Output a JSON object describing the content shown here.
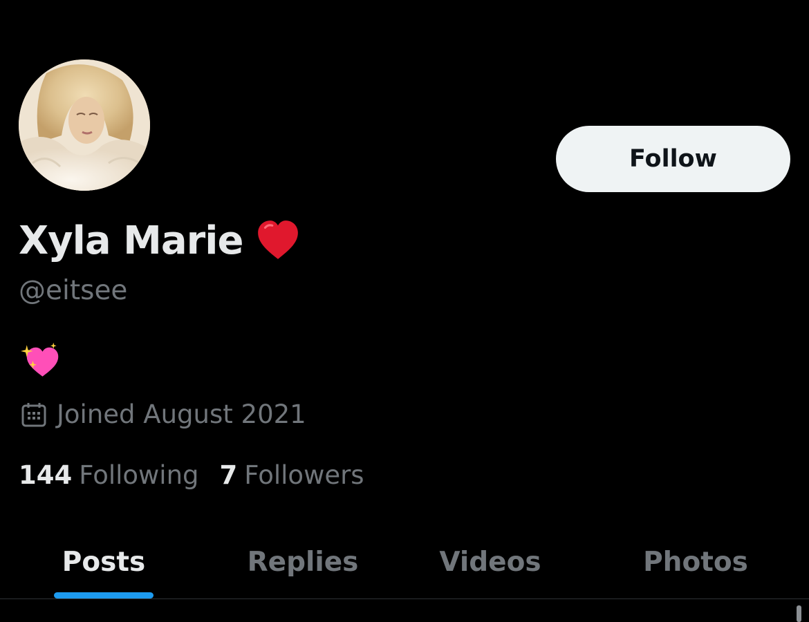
{
  "profile": {
    "display_name": "Xyla Marie",
    "name_emoji": "red-heart",
    "handle": "@eitsee",
    "bio_emoji": "sparkling-heart",
    "joined": "Joined August 2021",
    "following_count": "144",
    "following_label": "Following",
    "followers_count": "7",
    "followers_label": "Followers"
  },
  "actions": {
    "follow_label": "Follow"
  },
  "tabs": [
    {
      "label": "Posts",
      "active": true
    },
    {
      "label": "Replies",
      "active": false
    },
    {
      "label": "Videos",
      "active": false
    },
    {
      "label": "Photos",
      "active": false
    }
  ],
  "colors": {
    "background": "#000000",
    "primary_text": "#e7e9ea",
    "secondary_text": "#71767b",
    "accent": "#1d9bf0",
    "follow_button_bg": "#eff3f4",
    "heart": "#e0182d",
    "sparkle_heart": "#ff4fb8"
  }
}
